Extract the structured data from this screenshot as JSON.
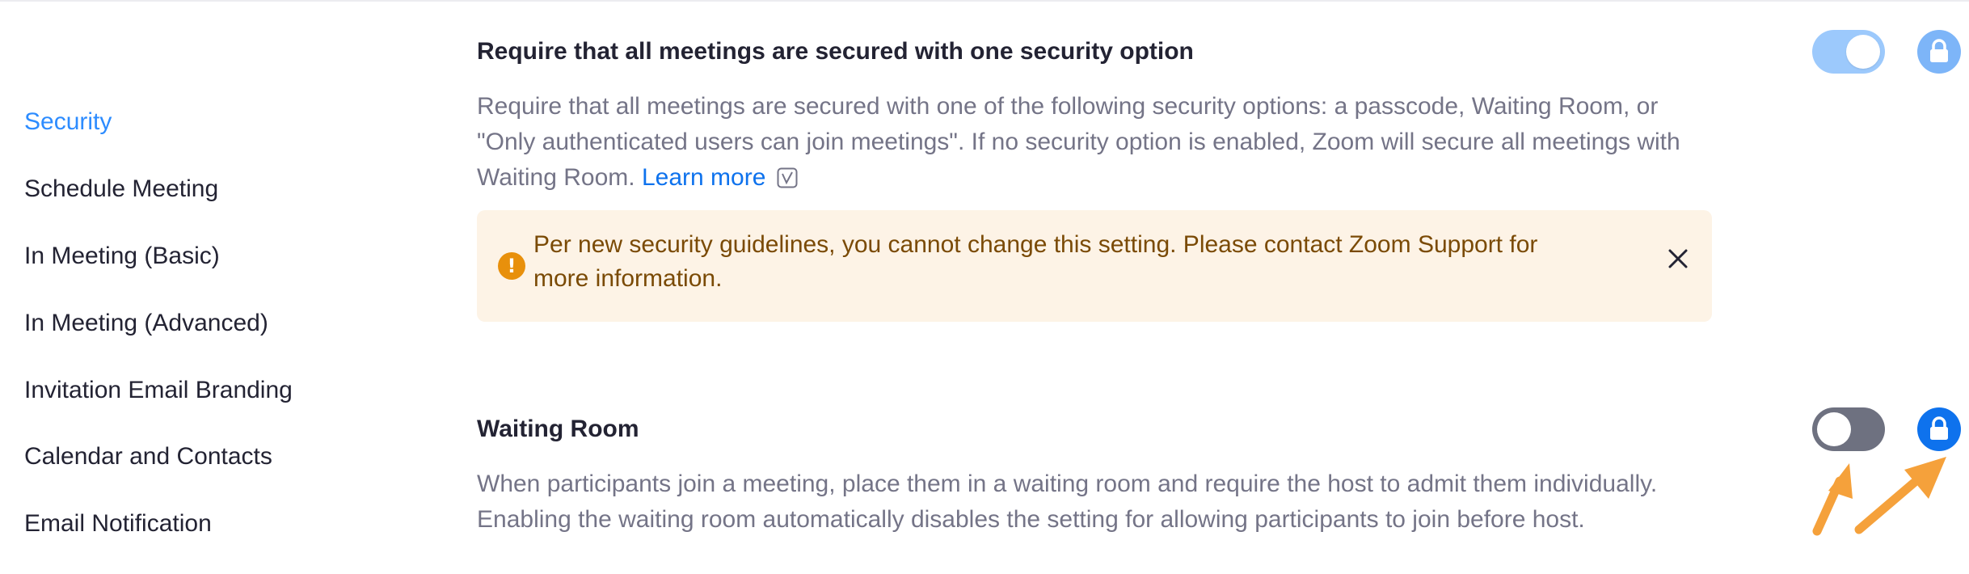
{
  "sidebar": {
    "items": [
      {
        "label": "Security",
        "active": true
      },
      {
        "label": "Schedule Meeting"
      },
      {
        "label": "In Meeting (Basic)"
      },
      {
        "label": "In Meeting (Advanced)"
      },
      {
        "label": "Invitation Email Branding"
      },
      {
        "label": "Calendar and Contacts"
      },
      {
        "label": "Email Notification"
      }
    ]
  },
  "settings": {
    "secure_option": {
      "title": "Require that all meetings are secured with one security option",
      "description": "Require that all meetings are secured with one of the following security options: a passcode, Waiting Room, or \"Only authenticated users can join meetings\". If no security option is enabled, Zoom will secure all meetings with Waiting Room.",
      "learn_more": "Learn more",
      "toggle_state": "on",
      "locked": true
    },
    "alert": {
      "icon": "exclamation-icon",
      "text": "Per new security guidelines, you cannot change this setting. Please contact Zoom Support for more information."
    },
    "waiting_room": {
      "title": "Waiting Room",
      "description": "When participants join a meeting, place them in a waiting room and require the host to admit them individually. Enabling the waiting room automatically disables the setting for allowing participants to join before host.",
      "toggle_state": "off",
      "locked": true
    }
  },
  "colors": {
    "accent": "#2d8cff",
    "link": "#0e72ed",
    "alert_bg": "#fdf3e6",
    "alert_text": "#7a4a05",
    "annotation_arrow": "#f5a13b"
  }
}
